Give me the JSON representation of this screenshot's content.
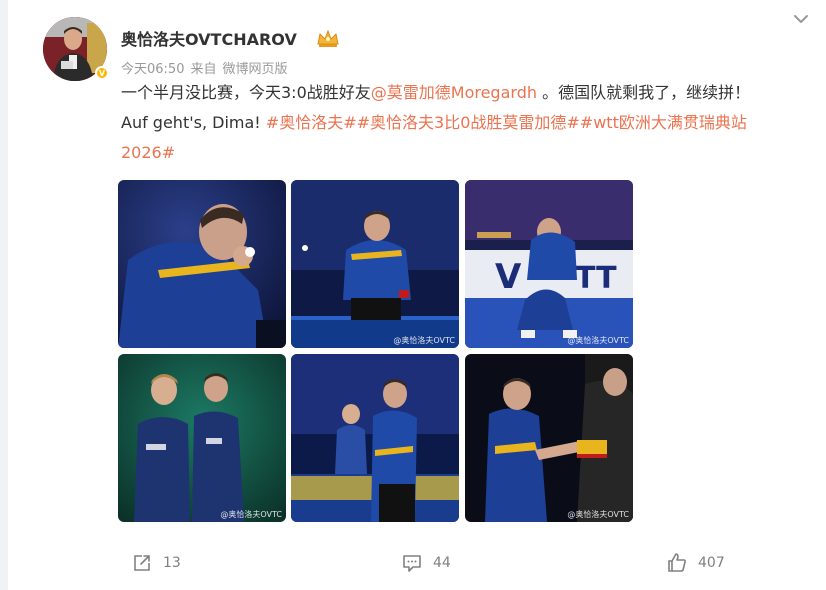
{
  "post": {
    "username": "奥恰洛夫OVTCHAROV",
    "verified_mark": "V",
    "timestamp": "今天06:50",
    "source_prefix": "来自",
    "source": "微博网页版",
    "text": {
      "line1_a": "一个半月没比赛，今天3:0战胜好友",
      "mention": "@莫雷加德Moregardh",
      "line1_b": " 。德国队就剩我了，继续拼！",
      "line2_a": "Auf geht's, Dima! ",
      "tag1": "#奥恰洛夫#",
      "tag2": "#奥恰洛夫3比0战胜莫雷加德#",
      "tag3_a": "#wtt欧洲大满贯瑞典站",
      "tag3_b": "2026#"
    },
    "watermark": "@奥恰洛夫OVTC"
  },
  "actions": {
    "repost_count": "13",
    "comment_count": "44",
    "like_count": "407"
  },
  "colors": {
    "accent": "#eb7350",
    "muted": "#999999",
    "text": "#333333"
  },
  "icons": [
    "chevron-down-icon",
    "crown-icon",
    "repost-icon",
    "comment-icon",
    "like-icon"
  ]
}
